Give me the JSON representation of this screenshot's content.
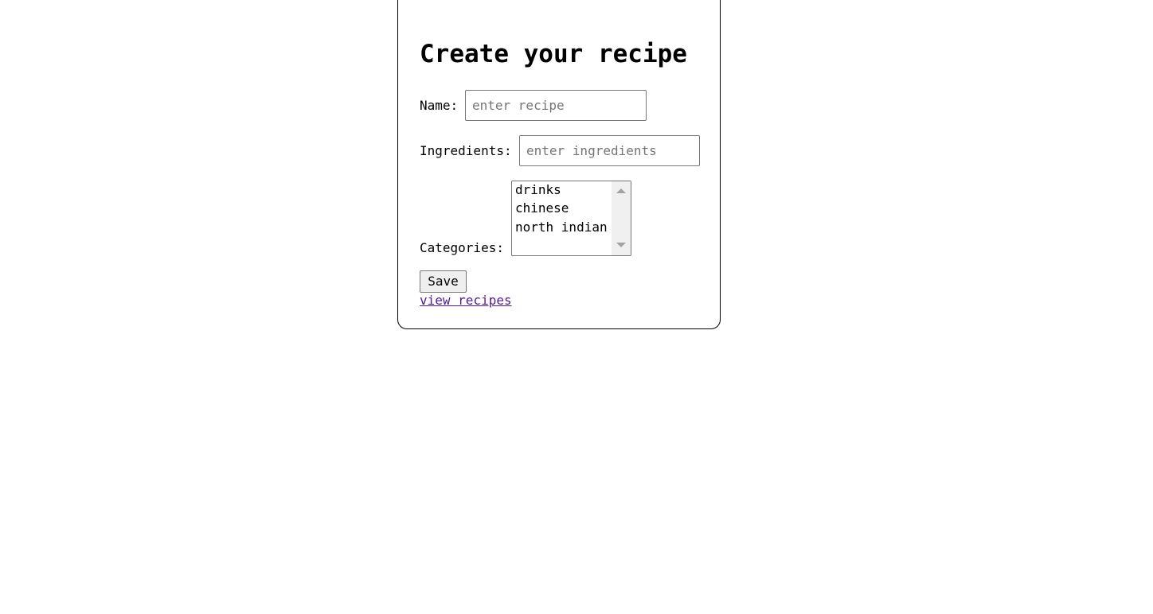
{
  "form": {
    "title": "Create your recipe",
    "name_label": "Name:",
    "name_placeholder": "enter recipe",
    "ingredients_label": "Ingredients:",
    "ingredients_placeholder": "enter ingredients",
    "categories_label": "Categories:",
    "categories": [
      "drinks",
      "chinese",
      "north indian"
    ],
    "save_label": "Save",
    "view_link": "view recipes"
  },
  "colors": {
    "link": "#551a8b",
    "border": "#767676",
    "button_bg": "#efefef"
  }
}
